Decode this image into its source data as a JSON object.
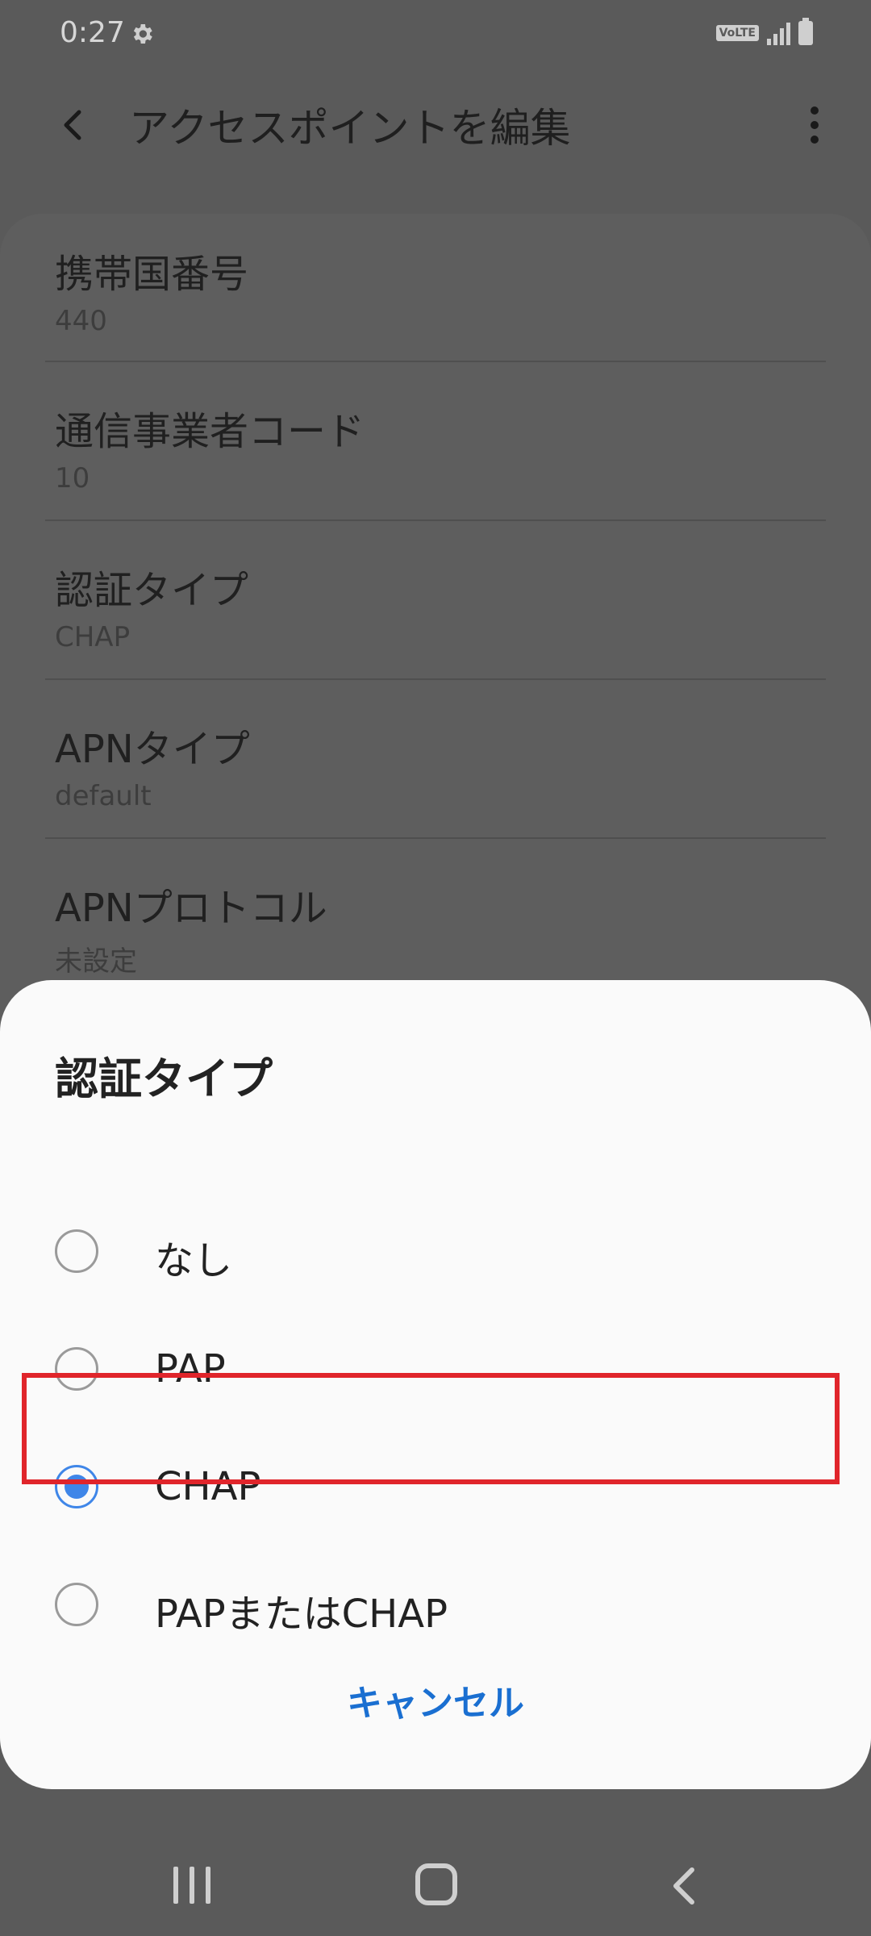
{
  "status_bar": {
    "time": "0:27",
    "volte": "VoLTE",
    "icons": [
      "gear-icon",
      "volte-icon",
      "signal-icon",
      "battery-icon"
    ]
  },
  "app_bar": {
    "title": "アクセスポイントを編集",
    "icons": [
      "back-arrow-icon",
      "more-vert-icon"
    ]
  },
  "settings": [
    {
      "label": "携帯国番号",
      "value": "440"
    },
    {
      "label": "通信事業者コード",
      "value": "10"
    },
    {
      "label": "認証タイプ",
      "value": "CHAP"
    },
    {
      "label": "APNタイプ",
      "value": "default"
    },
    {
      "label": "APNプロトコル",
      "value": "未設定"
    }
  ],
  "dialog": {
    "title": "認証タイプ",
    "options": [
      {
        "label": "なし",
        "selected": false
      },
      {
        "label": "PAP",
        "selected": false
      },
      {
        "label": "CHAP",
        "selected": true
      },
      {
        "label": "PAPまたはCHAP",
        "selected": false
      }
    ],
    "cancel_label": "キャンセル"
  },
  "colors": {
    "accent": "#3f86e8",
    "cancel": "#1a6fd1",
    "highlight": "#e0252b",
    "scrim": "#5a5a5a"
  },
  "nav_bar": {
    "icons": [
      "recents-icon",
      "home-icon",
      "back-icon"
    ]
  }
}
